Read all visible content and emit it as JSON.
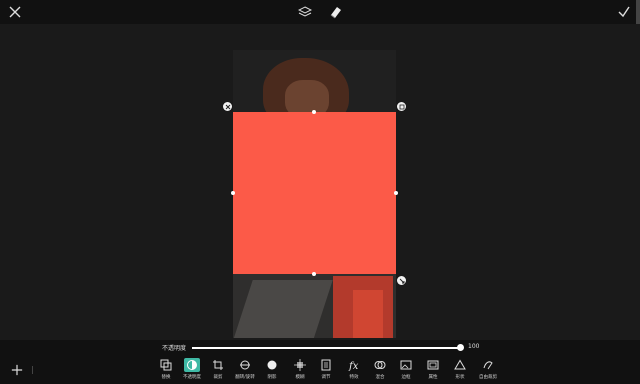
{
  "toolbar_top": {
    "close_icon": "close-icon",
    "layers_icon": "layers-icon",
    "eraser_icon": "eraser-icon",
    "confirm_icon": "check-icon"
  },
  "opacity": {
    "label": "不透明度",
    "value": "100",
    "level": 1.0
  },
  "colors": {
    "sticker": "#fc5a48",
    "accent": "#3fb9a5"
  },
  "tools": [
    {
      "label": "替换",
      "icon": "replace-icon"
    },
    {
      "label": "不透明度",
      "icon": "opacity-icon",
      "active": true
    },
    {
      "label": "裁剪",
      "icon": "crop-icon"
    },
    {
      "label": "翻转/旋转",
      "icon": "flip-rotate-icon"
    },
    {
      "label": "阴影",
      "icon": "shadow-icon"
    },
    {
      "label": "模糊",
      "icon": "blur-icon"
    },
    {
      "label": "调节",
      "icon": "adjust-icon"
    },
    {
      "label": "特效",
      "icon": "fx-icon"
    },
    {
      "label": "混合",
      "icon": "blend-icon"
    },
    {
      "label": "边框",
      "icon": "border-icon"
    },
    {
      "label": "属性",
      "icon": "properties-icon"
    },
    {
      "label": "形状",
      "icon": "shape-icon"
    },
    {
      "label": "自由裁剪",
      "icon": "freecrop-icon"
    }
  ]
}
